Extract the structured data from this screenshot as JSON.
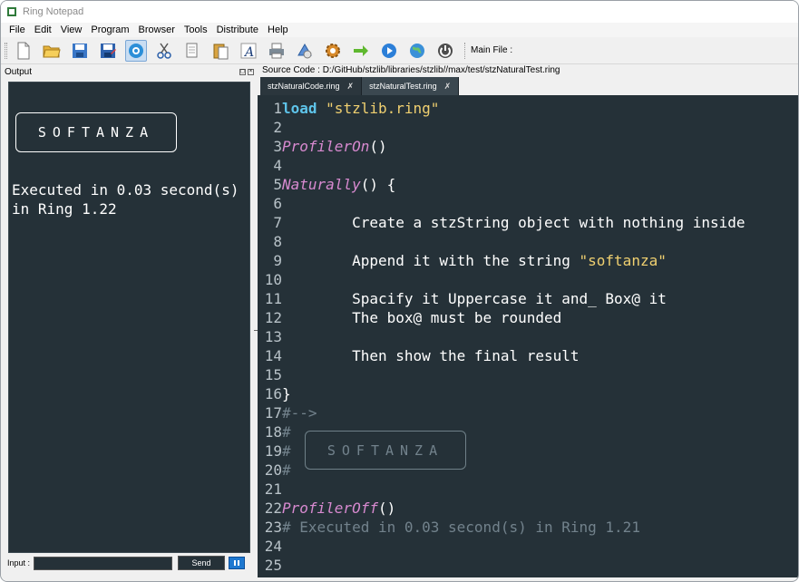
{
  "window": {
    "title": "Ring Notepad"
  },
  "menu": [
    "File",
    "Edit",
    "View",
    "Program",
    "Browser",
    "Tools",
    "Distribute",
    "Help"
  ],
  "toolbar": {
    "icons": [
      "new-file-icon",
      "open-folder-icon",
      "save-icon",
      "save-as-icon",
      "run-browser-icon",
      "cut-icon",
      "copy-icon",
      "paste-icon",
      "font-icon",
      "print-icon",
      "debug-icon",
      "settings-icon",
      "arrow-right-icon",
      "play-icon",
      "globe-icon",
      "power-icon"
    ],
    "main_file_label": "Main File :"
  },
  "output": {
    "title": "Output",
    "box_text": "SOFTANZA",
    "lines": [
      "Executed in 0.03 second(s)",
      "in Ring 1.22"
    ],
    "input_label": "Input :",
    "input_value": "",
    "send_label": "Send"
  },
  "source": {
    "label": "Source Code : D:/GitHub/stzlib/libraries/stzlib//max/test/stzNaturalTest.ring",
    "tabs": [
      {
        "label": "stzNaturalCode.ring",
        "close": "✗",
        "active": false
      },
      {
        "label": "stzNaturalTest.ring",
        "close": "✗",
        "active": true
      }
    ],
    "box_text": "SOFTANZA",
    "lines": [
      {
        "n": "1",
        "parts": [
          [
            "kw",
            "load"
          ],
          [
            "code",
            " "
          ],
          [
            "str",
            "\"stzlib.ring\""
          ]
        ]
      },
      {
        "n": "2",
        "parts": []
      },
      {
        "n": "3",
        "parts": [
          [
            "fn",
            "ProfilerOn"
          ],
          [
            "code",
            "()"
          ]
        ]
      },
      {
        "n": "4",
        "parts": []
      },
      {
        "n": "5",
        "parts": [
          [
            "fn",
            "Naturally"
          ],
          [
            "code",
            "() {"
          ]
        ]
      },
      {
        "n": "6",
        "parts": []
      },
      {
        "n": "7",
        "parts": [
          [
            "code",
            "        Create a stzString object with nothing inside"
          ]
        ]
      },
      {
        "n": "8",
        "parts": []
      },
      {
        "n": "9",
        "parts": [
          [
            "code",
            "        Append it with the string "
          ],
          [
            "str",
            "\"softanza\""
          ]
        ]
      },
      {
        "n": "10",
        "parts": []
      },
      {
        "n": "11",
        "parts": [
          [
            "code",
            "        Spacify it Uppercase it and_ Box@ it"
          ]
        ]
      },
      {
        "n": "12",
        "parts": [
          [
            "code",
            "        The box@ must be rounded"
          ]
        ]
      },
      {
        "n": "13",
        "parts": []
      },
      {
        "n": "14",
        "parts": [
          [
            "code",
            "        Then show the final result"
          ]
        ]
      },
      {
        "n": "15",
        "parts": []
      },
      {
        "n": "16",
        "parts": [
          [
            "code",
            "}"
          ]
        ]
      },
      {
        "n": "17",
        "parts": [
          [
            "cm",
            "#-->"
          ]
        ]
      },
      {
        "n": "18",
        "parts": [
          [
            "cm",
            "#"
          ]
        ]
      },
      {
        "n": "19",
        "parts": [
          [
            "cm",
            "#"
          ]
        ]
      },
      {
        "n": "20",
        "parts": [
          [
            "cm",
            "#"
          ]
        ]
      },
      {
        "n": "21",
        "parts": []
      },
      {
        "n": "22",
        "parts": [
          [
            "fn",
            "ProfilerOff"
          ],
          [
            "code",
            "()"
          ]
        ]
      },
      {
        "n": "23",
        "parts": [
          [
            "cm",
            "# Executed in 0.03 second(s) in Ring 1.21"
          ]
        ]
      },
      {
        "n": "24",
        "parts": []
      },
      {
        "n": "25",
        "parts": []
      }
    ]
  }
}
